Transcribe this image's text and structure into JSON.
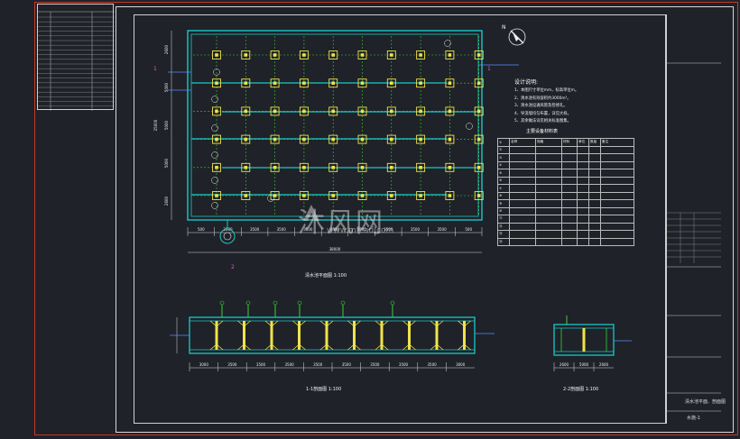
{
  "drawing": {
    "plan_caption": "清水池平面图 1:100",
    "section1_caption": "1-1剖面图 1:100",
    "section2_caption": "2-2剖面图 1:100",
    "north_label": "N",
    "plan_tag": "1"
  },
  "design_notes": {
    "title": "设计说明:",
    "lines": [
      "1、本图尺寸单位mm，标高单位m。",
      "2、清水池有效容积约3000m³。",
      "3、清水池设通风管及检修孔。",
      "4、导流墙均匀布置，详见大样。",
      "5、其余做法详见相关标准图集。"
    ]
  },
  "materials": {
    "title": "主要设备材料表",
    "rows": [
      [
        "①",
        "名称",
        "规格",
        "材料",
        "单位",
        "数量",
        "备注"
      ],
      [
        "②",
        "",
        "",
        "",
        "",
        "",
        ""
      ],
      [
        "③",
        "",
        "",
        "",
        "",
        "",
        ""
      ],
      [
        "④",
        "",
        "",
        "",
        "",
        "",
        ""
      ],
      [
        "⑤",
        "",
        "",
        "",
        "",
        "",
        ""
      ],
      [
        "⑥",
        "",
        "",
        "",
        "",
        "",
        ""
      ],
      [
        "⑦",
        "",
        "",
        "",
        "",
        "",
        ""
      ],
      [
        "⑧",
        "",
        "",
        "",
        "",
        "",
        ""
      ],
      [
        "⑨",
        "",
        "",
        "",
        "",
        "",
        ""
      ],
      [
        "⑩",
        "",
        "",
        "",
        "",
        "",
        ""
      ],
      [
        "⑪",
        "",
        "",
        "",
        "",
        "",
        ""
      ],
      [
        "⑫",
        "",
        "",
        "",
        "",
        "",
        ""
      ],
      [
        "⑬",
        "",
        "",
        "",
        "",
        "",
        ""
      ],
      [
        "⑭",
        "",
        "",
        "",
        "",
        "",
        ""
      ]
    ]
  },
  "plan_dimensions": {
    "bottom": [
      "500",
      "3500",
      "3500",
      "3500",
      "3500",
      "3500",
      "3500",
      "3500",
      "3500",
      "3500",
      "500"
    ],
    "total": "38000",
    "left": [
      "2600",
      "5000",
      "5000",
      "5000",
      "2600"
    ],
    "left_total": "25000"
  },
  "section1_dims": [
    "3000",
    "3500",
    "3500",
    "3500",
    "3500",
    "3500",
    "3500",
    "3500",
    "3500",
    "3000"
  ],
  "section2_dims": [
    "2600",
    "5000",
    "2600"
  ],
  "watermark": {
    "text": "沐风网",
    "url": "www.mfcad.com"
  },
  "title_block": {
    "labels": [
      "审定",
      "审核",
      "校对",
      "设计",
      "制图",
      "图号",
      "日期"
    ],
    "drawing_name": "清水池平面、剖面图",
    "sheet": "水施-1"
  },
  "colors": {
    "background": "#1f2228",
    "frame_red": "#c0392b",
    "structure_cyan": "#19c8c8",
    "column_yellow": "#f0e34a",
    "grid_green": "#37d13a",
    "annotation_blue": "#5a8cff",
    "marker_magenta": "#e54fd9"
  }
}
